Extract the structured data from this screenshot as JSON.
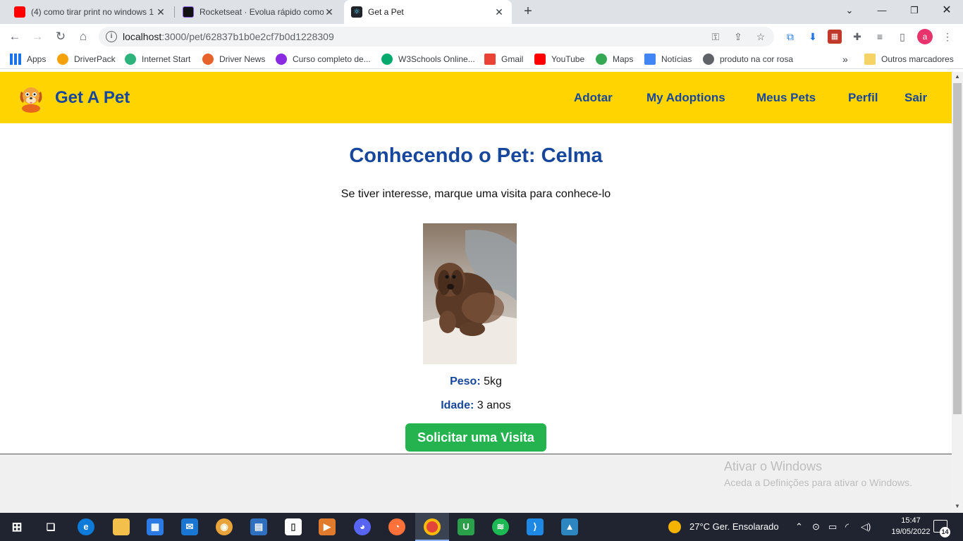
{
  "browser": {
    "tabs": [
      {
        "title": "(4) como tirar print no windows 1",
        "favicon": "youtube-icon"
      },
      {
        "title": "Rocketseat · Evolua rápido como",
        "favicon": "rocketseat-icon"
      },
      {
        "title": "Get a Pet",
        "favicon": "react-icon",
        "active": true
      }
    ],
    "url_host": "localhost",
    "url_path": ":3000/pet/62837b1b0e2cf7b0d1228309",
    "profile_initial": "a",
    "bookmarks": [
      {
        "label": "Apps",
        "icon": "apps-grid-icon",
        "color": "#1a73e8"
      },
      {
        "label": "DriverPack",
        "icon": "driverpack-icon",
        "color": "#f4a20b"
      },
      {
        "label": "Internet Start",
        "icon": "internet-start-icon",
        "color": "#2db37b"
      },
      {
        "label": "Driver News",
        "icon": "driver-news-icon",
        "color": "#e8632b"
      },
      {
        "label": "Curso completo de...",
        "icon": "course-icon",
        "color": "#8a2be2"
      },
      {
        "label": "W3Schools Online...",
        "icon": "w3schools-icon",
        "color": "#04aa6d"
      },
      {
        "label": "Gmail",
        "icon": "gmail-icon",
        "color": "#ea4335"
      },
      {
        "label": "YouTube",
        "icon": "youtube-icon",
        "color": "#ff0000"
      },
      {
        "label": "Maps",
        "icon": "maps-icon",
        "color": "#34a853"
      },
      {
        "label": "Notícias",
        "icon": "news-icon",
        "color": "#4285f4"
      },
      {
        "label": "produto na cor rosa",
        "icon": "globe-icon",
        "color": "#5f6368"
      }
    ],
    "other_bookmarks": "Outros marcadores"
  },
  "app": {
    "brand": "Get A Pet",
    "nav": [
      "Adotar",
      "My Adoptions",
      "Meus Pets",
      "Perfil",
      "Sair"
    ],
    "colors": {
      "navbar": "#ffd400",
      "primary": "#16479d",
      "button": "#25b350"
    }
  },
  "pet": {
    "title": "Conhecendo o Pet: Celma",
    "subtitle": "Se tiver interesse, marque uma visita para conhece-lo",
    "weight_label": "Peso:",
    "weight_value": "5kg",
    "age_label": "Idade:",
    "age_value": "3 anos",
    "button": "Solicitar uma Visita"
  },
  "windows": {
    "activation_title": "Ativar o Windows",
    "activation_sub": "Aceda a Definições para ativar o Windows.",
    "weather": "27°C  Ger. Ensolarado",
    "time": "15:47",
    "date": "19/05/2022",
    "notifications": "14"
  }
}
